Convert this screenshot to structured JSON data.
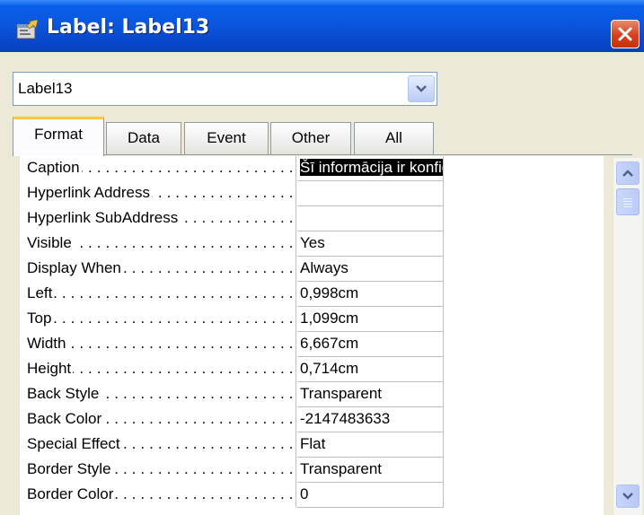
{
  "window": {
    "title": "Label: Label13",
    "icon": "properties-sheet-icon",
    "close_icon": "close-icon"
  },
  "object_selector": {
    "value": "Label13"
  },
  "tabs": [
    {
      "label": "Format",
      "active": true
    },
    {
      "label": "Data",
      "active": false
    },
    {
      "label": "Event",
      "active": false
    },
    {
      "label": "Other",
      "active": false
    },
    {
      "label": "All",
      "active": false
    }
  ],
  "properties": [
    {
      "name": "Caption",
      "value": "Šī informācija ir konfidenciāla",
      "selected": true
    },
    {
      "name": "Hyperlink Address",
      "value": ""
    },
    {
      "name": "Hyperlink SubAddress",
      "value": ""
    },
    {
      "name": "Visible",
      "value": "Yes"
    },
    {
      "name": "Display When",
      "value": "Always"
    },
    {
      "name": "Left",
      "value": "0,998cm"
    },
    {
      "name": "Top",
      "value": "1,099cm"
    },
    {
      "name": "Width",
      "value": "6,667cm"
    },
    {
      "name": "Height",
      "value": "0,714cm"
    },
    {
      "name": "Back Style",
      "value": "Transparent"
    },
    {
      "name": "Back Color",
      "value": "-2147483633"
    },
    {
      "name": "Special Effect",
      "value": "Flat"
    },
    {
      "name": "Border Style",
      "value": "Transparent"
    },
    {
      "name": "Border Color",
      "value": "0"
    }
  ],
  "colors": {
    "titlebar": "#0b56df",
    "active_tab_accent": "#ffc83c",
    "close_button": "#d8401b",
    "dialog_face": "#ece9d8"
  }
}
